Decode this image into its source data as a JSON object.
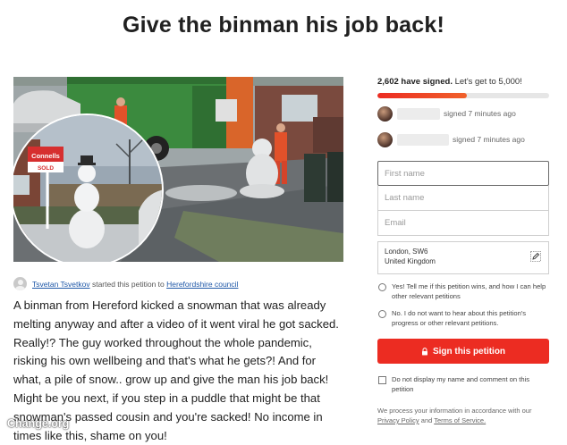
{
  "title": "Give the binman his job back!",
  "author": {
    "name": "Tsvetan Tsvetkov",
    "middle": "started this petition to",
    "target": "Herefordshire council"
  },
  "description": "A binman from Hereford kicked a snowman that was already melting anyway and after a video of it went viral he got sacked. Really!? The guy worked throughout the whole pandemic, risking his own wellbeing and that's what he gets?! And for what, a pile of snow.. grow up and give the man his job back! Might be you next, if you step in a puddle that might be that snowman's passed cousin and you're sacked! No income in times like this, shame on you!",
  "watermark": "Change.org",
  "photo": {
    "sign_brand": "Connells",
    "sign_status": "SOLD"
  },
  "signatures": {
    "count_bold": "2,602 have signed.",
    "goal_text": "Let's get to 5,000!",
    "progress_fraction": 0.52
  },
  "recent": [
    {
      "time": "signed 7 minutes ago"
    },
    {
      "time": "signed 7 minutes ago"
    }
  ],
  "form": {
    "first_name": "First name",
    "last_name": "Last name",
    "email": "Email",
    "location_line1": "London, SW6",
    "location_line2": "United Kingdom",
    "opt_in_yes": "Yes! Tell me if this petition wins, and how I can help other relevant petitions",
    "opt_in_no": "No. I do not want to hear about this petition's progress or other relevant petitions.",
    "sign_button": "Sign this petition",
    "hide_name": "Do not display my name and comment on this petition",
    "privacy_prefix": "We process your information in accordance with our",
    "privacy_link": "Privacy Policy",
    "privacy_and": "and",
    "terms_link": "Terms of Service."
  },
  "colors": {
    "accent": "#ec2c22",
    "link": "#1e57a7"
  },
  "icons": {
    "lock": "lock-icon",
    "edit": "pencil-icon",
    "avatar": "user-icon"
  }
}
